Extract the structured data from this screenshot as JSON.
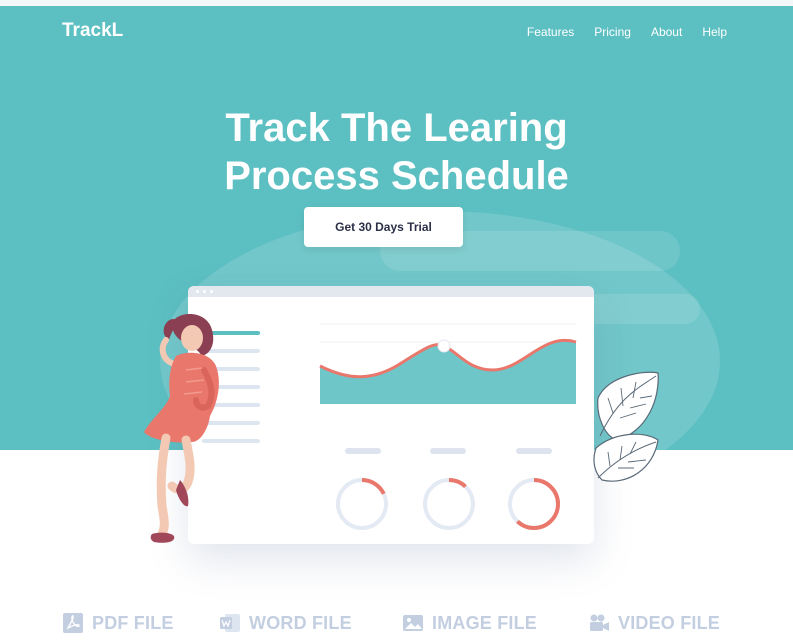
{
  "brand": {
    "name": "TrackL"
  },
  "nav": {
    "items": [
      {
        "label": "Features"
      },
      {
        "label": "Pricing"
      },
      {
        "label": "About"
      },
      {
        "label": "Help"
      }
    ]
  },
  "hero": {
    "headline_line1": "Track The Learing",
    "headline_line2": "Process Schedule",
    "cta_label": "Get 30 Days Trial"
  },
  "dashboard": {
    "rings": [
      {
        "progress": 0.18
      },
      {
        "progress": 0.12
      },
      {
        "progress": 0.62
      }
    ]
  },
  "file_types": [
    {
      "label": "PDF FILE",
      "icon": "pdf-file-icon"
    },
    {
      "label": "WORD FILE",
      "icon": "word-file-icon"
    },
    {
      "label": "IMAGE FILE",
      "icon": "image-file-icon"
    },
    {
      "label": "VIDEO FILE",
      "icon": "video-file-icon"
    }
  ],
  "colors": {
    "accent": "#5cbfc2",
    "coral": "#e9776b",
    "heading": "#2c2f48",
    "muted": "#c3cfe1"
  }
}
